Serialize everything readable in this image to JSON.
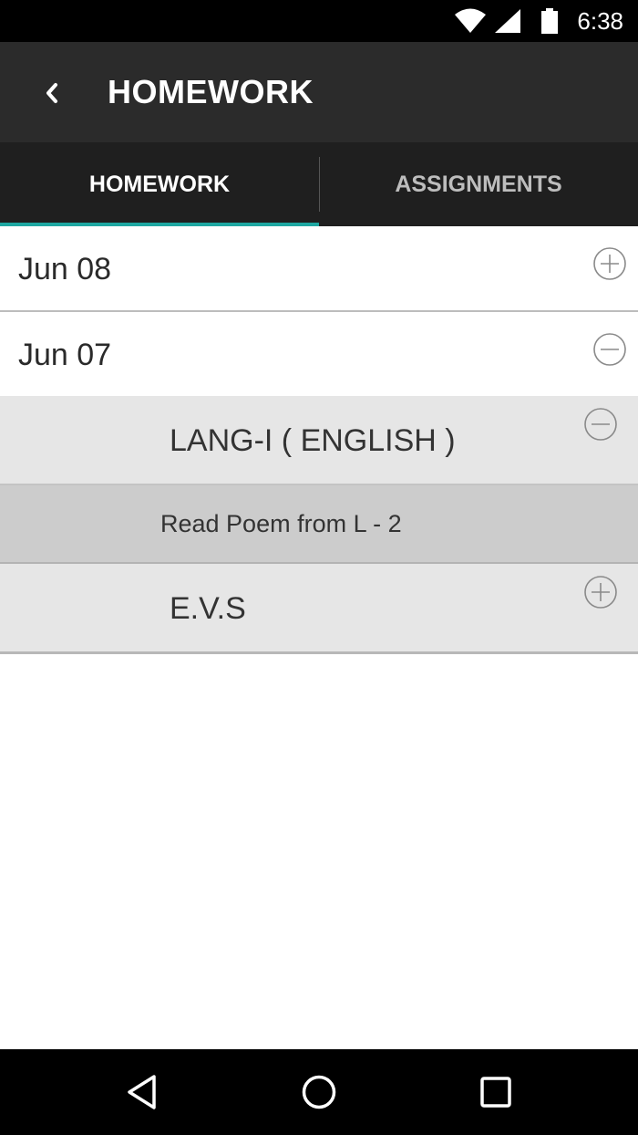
{
  "status_bar": {
    "time": "6:38",
    "icons": [
      "wifi-icon",
      "signal-icon",
      "battery-icon"
    ]
  },
  "app_bar": {
    "title": "HOMEWORK",
    "back_icon": "back-chevron-icon"
  },
  "tabs": [
    {
      "label": "HOMEWORK",
      "selected": true
    },
    {
      "label": "ASSIGNMENTS",
      "selected": false
    }
  ],
  "colors": {
    "accent": "#1ea7a1",
    "app_bar": "#2b2b2b",
    "tab_bar": "#1f1f1f"
  },
  "dates": [
    {
      "label": "Jun 08",
      "expanded": false,
      "icon": "expand-plus-icon"
    },
    {
      "label": "Jun 07",
      "expanded": true,
      "icon": "collapse-minus-icon",
      "subjects": [
        {
          "label": "LANG-I ( ENGLISH )",
          "expanded": true,
          "icon": "collapse-minus-icon",
          "items": [
            "Read Poem from L - 2"
          ]
        },
        {
          "label": "E.V.S",
          "expanded": false,
          "icon": "expand-plus-icon"
        }
      ]
    }
  ],
  "nav_bar": {
    "icons": [
      "back-nav-icon",
      "home-nav-icon",
      "recents-nav-icon"
    ]
  }
}
